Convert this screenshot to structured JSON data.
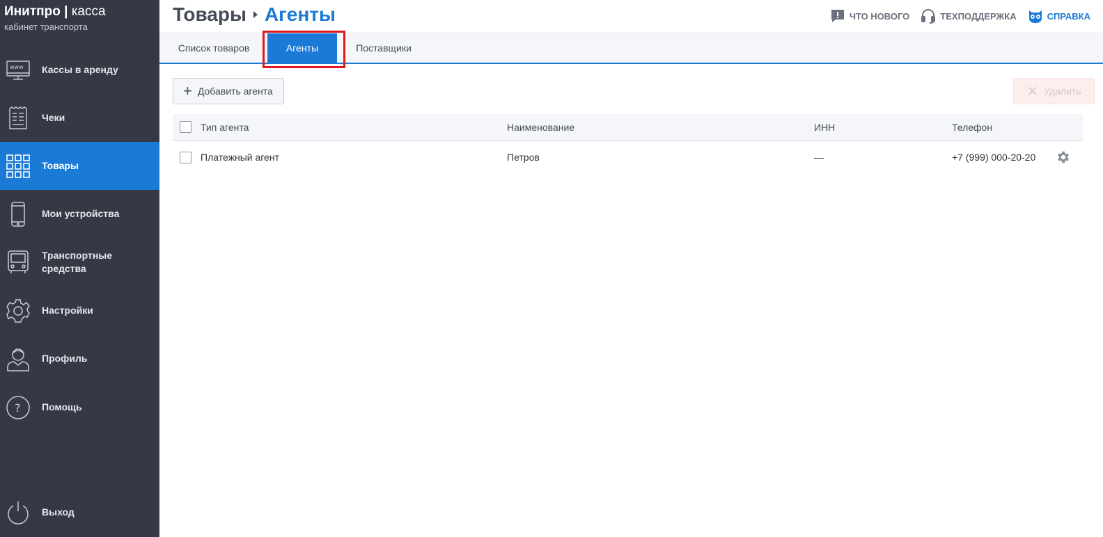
{
  "brand": {
    "name_bold": "Инитпро",
    "separator": "|",
    "name_light": "касса",
    "subtitle": "кабинет транспорта"
  },
  "sidebar": {
    "items": [
      {
        "label": "Кассы в аренду",
        "icon": "monitor-www-icon",
        "active": false
      },
      {
        "label": "Чеки",
        "icon": "receipt-icon",
        "active": false
      },
      {
        "label": "Товары",
        "icon": "grid-icon",
        "active": true
      },
      {
        "label": "Мои устройства",
        "icon": "phone-icon",
        "active": false
      },
      {
        "label": "Транспортные средства",
        "icon": "bus-icon",
        "active": false
      },
      {
        "label": "Настройки",
        "icon": "gear-icon",
        "active": false
      },
      {
        "label": "Профиль",
        "icon": "user-icon",
        "active": false
      },
      {
        "label": "Помощь",
        "icon": "question-icon",
        "active": false
      }
    ],
    "logout": {
      "label": "Выход",
      "icon": "power-icon"
    }
  },
  "header": {
    "breadcrumb_root": "Товары",
    "breadcrumb_current": "Агенты",
    "links": {
      "whats_new": "ЧТО НОВОГО",
      "support": "ТЕХПОДДЕРЖКА",
      "help": "СПРАВКА"
    }
  },
  "tabs": [
    {
      "label": "Список товаров",
      "active": false
    },
    {
      "label": "Агенты",
      "active": true
    },
    {
      "label": "Поставщики",
      "active": false
    }
  ],
  "toolbar": {
    "add_label": "Добавить агента",
    "delete_label": "Удалить"
  },
  "table": {
    "columns": [
      "Тип агента",
      "Наименование",
      "ИНН",
      "Телефон"
    ],
    "rows": [
      {
        "type": "Платежный агент",
        "name": "Петров",
        "inn": "—",
        "phone": "+7 (999) 000-20-20"
      }
    ]
  },
  "colors": {
    "accent": "#1a7ad6",
    "sidebar": "#353945",
    "highlight": "#e0181e"
  }
}
